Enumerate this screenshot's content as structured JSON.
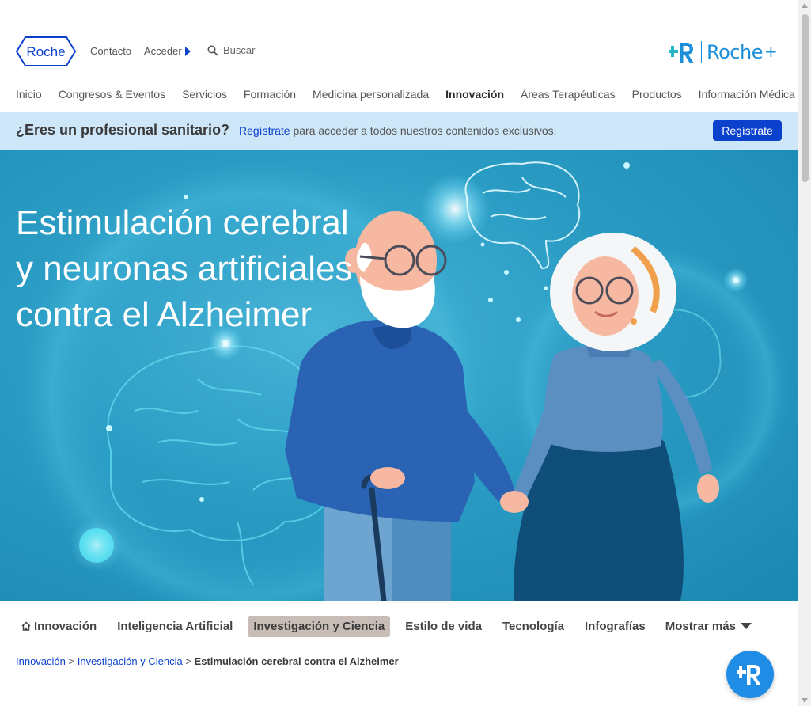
{
  "header": {
    "logo_text": "Roche",
    "contact_label": "Contacto",
    "login_label": "Acceder",
    "search_label": "Buscar",
    "brand_plus_text": "Roche+",
    "brand_plus_word": "Roche",
    "brand_plus_sign": "+"
  },
  "nav": {
    "items": [
      {
        "label": "Inicio",
        "active": false
      },
      {
        "label": "Congresos & Eventos",
        "active": false
      },
      {
        "label": "Servicios",
        "active": false
      },
      {
        "label": "Formación",
        "active": false
      },
      {
        "label": "Medicina personalizada",
        "active": false
      },
      {
        "label": "Innovación",
        "active": true
      },
      {
        "label": "Áreas Terapéuticas",
        "active": false
      },
      {
        "label": "Productos",
        "active": false
      },
      {
        "label": "Información Médica",
        "active": false
      }
    ]
  },
  "banner": {
    "question": "¿Eres un profesional sanitario?",
    "link_text": "Regístrate",
    "text": " para acceder a todos nuestros contenidos exclusivos.",
    "button_label": "Regístrate"
  },
  "hero": {
    "title_line1": "Estimulación cerebral",
    "title_line2": "y neuronas artificiales",
    "title_line3": "contra el Alzheimer"
  },
  "subnav": {
    "tabs": [
      {
        "label": "Innovación",
        "icon": "home-icon",
        "active": false
      },
      {
        "label": "Inteligencia Artificial",
        "active": false
      },
      {
        "label": "Investigación y Ciencia",
        "active": true
      },
      {
        "label": "Estilo de vida",
        "active": false
      },
      {
        "label": "Tecnología",
        "active": false
      },
      {
        "label": "Infografías",
        "active": false
      }
    ],
    "more_label": "Mostrar más"
  },
  "breadcrumb": {
    "items": [
      "Innovación",
      "Investigación y Ciencia"
    ],
    "separator": ">",
    "current": "Estimulación cerebral contra el Alzheimer"
  },
  "colors": {
    "brand_blue": "#0b41cd",
    "rocheplus_blue": "#1d8fd8",
    "banner_bg": "#cde6f8",
    "hero_bg": "#2a9cc4",
    "active_tab_bg": "#c8bcb6"
  }
}
